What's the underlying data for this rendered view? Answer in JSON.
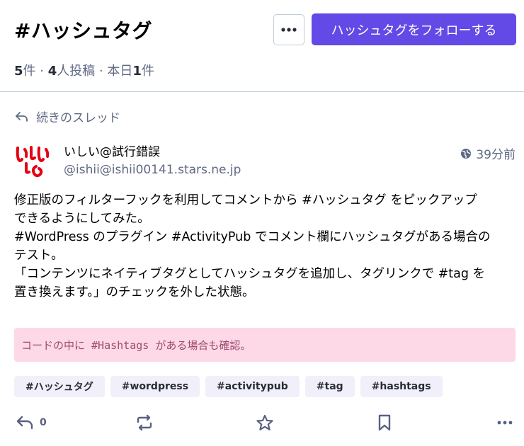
{
  "header": {
    "title": "#ハッシュタグ",
    "follow_label": "ハッシュタグをフォローする",
    "stats": {
      "posts_count": "5",
      "posts_unit": "件 · ",
      "users_count": "4",
      "users_unit": "人投稿 · 本日",
      "today_count": "1",
      "today_unit": "件"
    }
  },
  "thread": {
    "label": "続きのスレッド"
  },
  "post": {
    "author_name": "いしい@試行錯誤",
    "author_handle": "@ishii@ishii00141.stars.ne.jp",
    "time": "39分前",
    "avatar_text": "いしい",
    "lines": [
      "修正版のフィルターフックを利用してコメントから #ハッシュタグ をピックアップ",
      "できるようにしてみた。",
      "#WordPress のプラグイン #ActivityPub でコメント欄にハッシュタグがある場合の",
      "テスト。",
      "「コンテンツにネイティブタグとしてハッシュタグを追加し、タグリンクで #tag を",
      "置き換えます。」のチェックを外した状態。"
    ],
    "code": "コードの中に #Hashtags がある場合も確認。",
    "tags": [
      "#ハッシュタグ",
      "#wordpress",
      "#activitypub",
      "#tag",
      "#hashtags"
    ],
    "reply_count": "0"
  },
  "colors": {
    "accent": "#6349e5",
    "code_bg": "#fdd8e6",
    "avatar_red": "#e60012"
  }
}
